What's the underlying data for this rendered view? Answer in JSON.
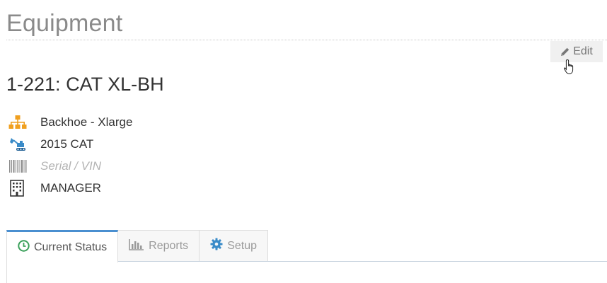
{
  "page": {
    "title": "Equipment"
  },
  "toolbar": {
    "edit_label": "Edit"
  },
  "equipment": {
    "number": "1-221:",
    "name": "CAT XL-BH"
  },
  "details": {
    "category": "Backhoe - Xlarge",
    "make_model": "2015 CAT",
    "serial_placeholder": "Serial / VIN",
    "owner": "MANAGER"
  },
  "tabs": [
    {
      "label": "Current Status",
      "icon": "clock-icon",
      "active": true
    },
    {
      "label": "Reports",
      "icon": "bar-chart-icon",
      "active": false
    },
    {
      "label": "Setup",
      "icon": "gear-icon",
      "active": false
    }
  ],
  "colors": {
    "accent": "#4a8fd0",
    "category_icon": "#f0a020",
    "equipment_icon": "#3a8bc8",
    "status_icon": "#3aa05a",
    "setup_icon": "#3a8bc8"
  }
}
